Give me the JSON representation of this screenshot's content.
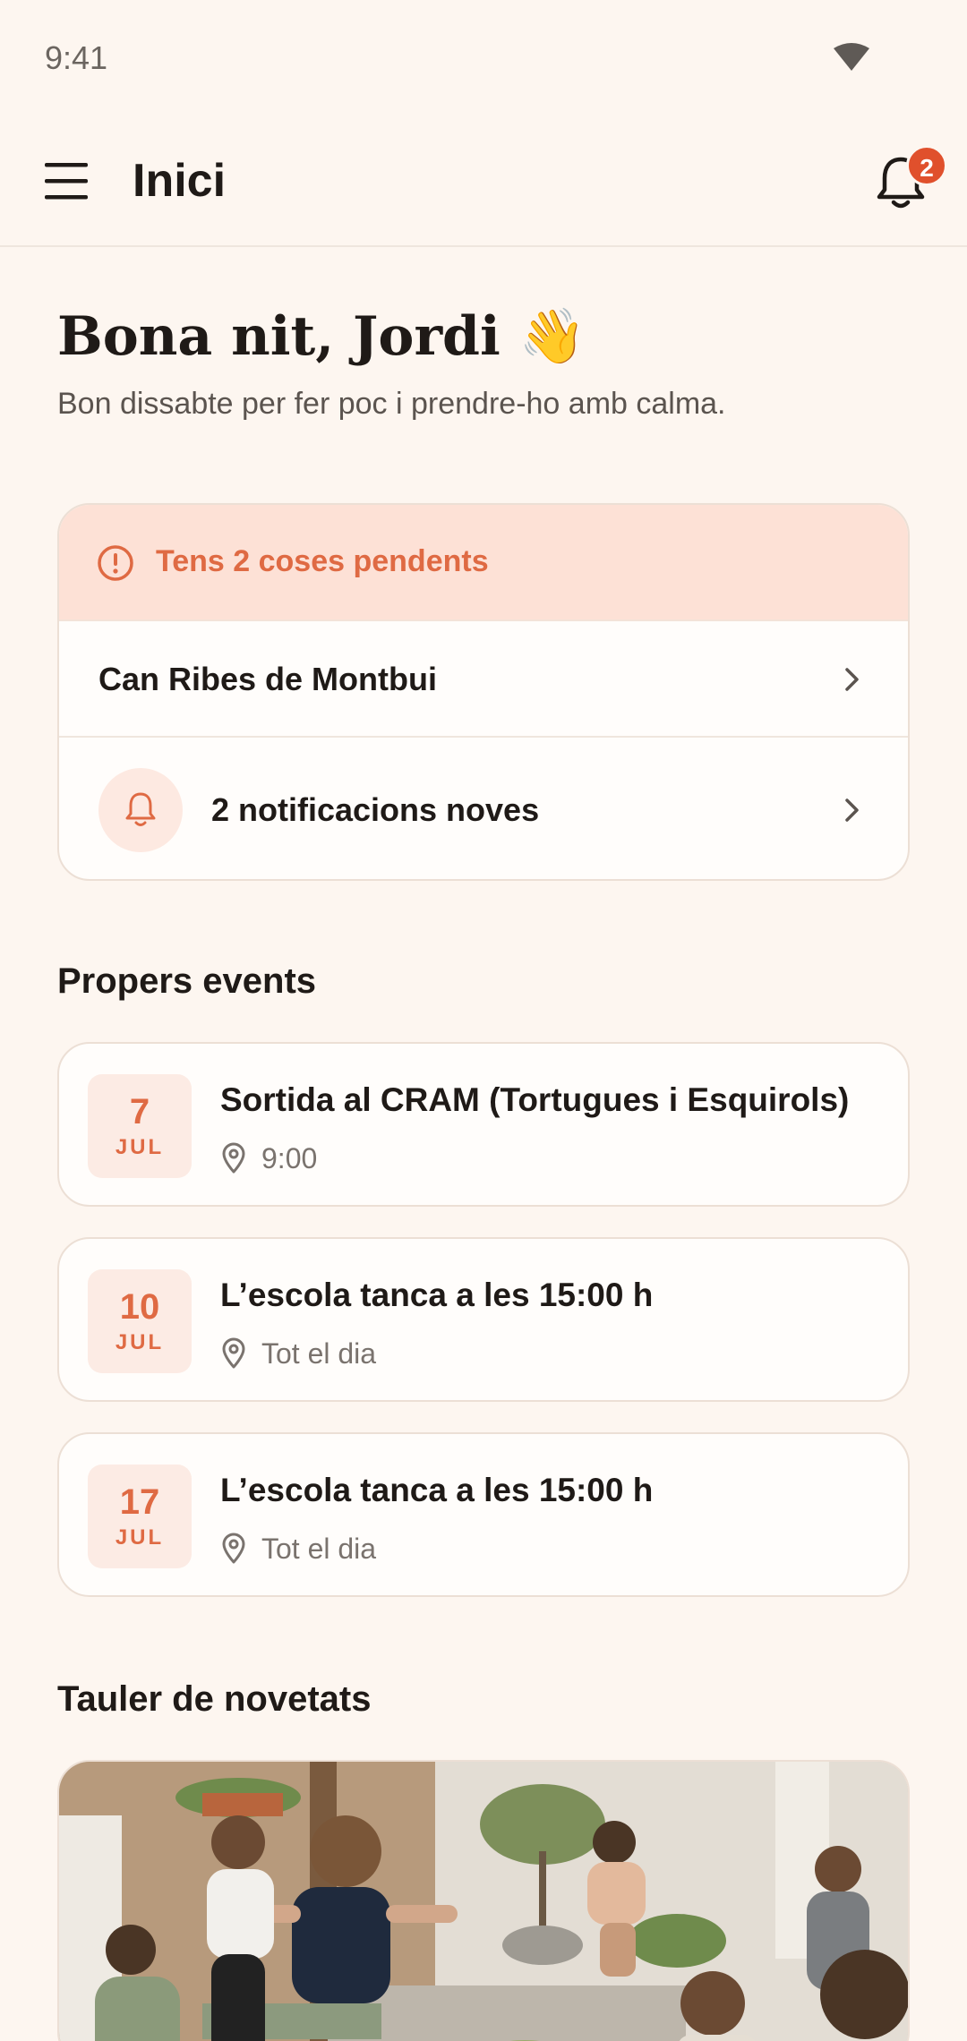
{
  "status_bar": {
    "time": "9:41"
  },
  "app_bar": {
    "title": "Inici",
    "notification_count": "2"
  },
  "greeting": {
    "title": "Bona nit, Jordi 👋",
    "subtitle": "Bon dissabte per fer poc i prendre-ho amb calma."
  },
  "pending": {
    "title": "Tens 2 coses pendents",
    "items": [
      {
        "label": "Can Ribes de Montbui"
      },
      {
        "label": "2 notificacions noves"
      }
    ]
  },
  "events": {
    "title": "Propers events",
    "items": [
      {
        "day": "7",
        "month": "JUL",
        "title": "Sortida al CRAM (Tortugues i Esquirols)",
        "meta": "9:00"
      },
      {
        "day": "10",
        "month": "JUL",
        "title": "L’escola tanca a les 15:00 h",
        "meta": "Tot el dia"
      },
      {
        "day": "17",
        "month": "JUL",
        "title": "L’escola tanca a les 15:00 h",
        "meta": "Tot el dia"
      }
    ]
  },
  "board": {
    "title": "Tauler de novetats"
  },
  "colors": {
    "accent": "#df6a43",
    "badge": "#e0502c",
    "background": "#fdf6f0"
  }
}
